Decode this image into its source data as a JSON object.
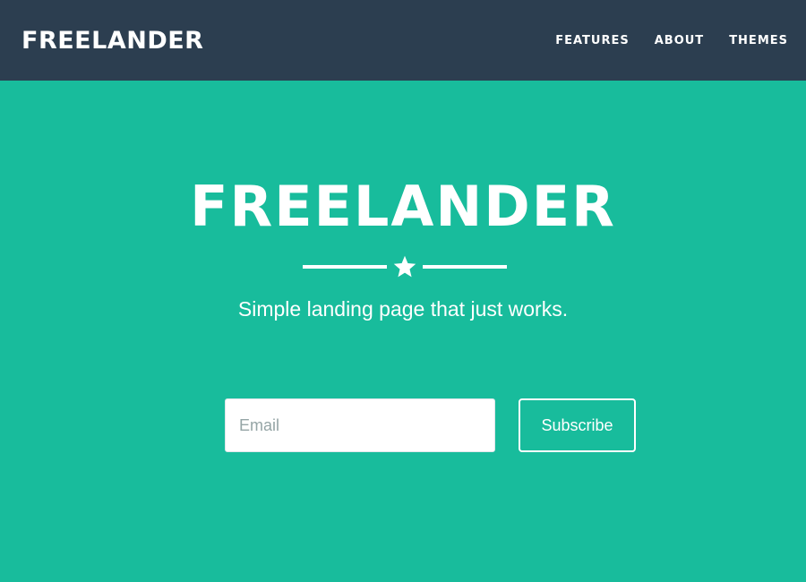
{
  "navbar": {
    "brand": "FREELANDER",
    "links": [
      "FEATURES",
      "ABOUT",
      "THEMES"
    ]
  },
  "hero": {
    "title": "FREELANDER",
    "tagline": "Simple landing page that just works.",
    "divider_icon": "star-icon"
  },
  "form": {
    "email_placeholder": "Email",
    "email_value": "",
    "subscribe_label": "Subscribe"
  },
  "colors": {
    "navbar_bg": "#2c3e50",
    "hero_bg": "#18bc9c",
    "text": "#ffffff",
    "placeholder": "#95a5a6"
  }
}
